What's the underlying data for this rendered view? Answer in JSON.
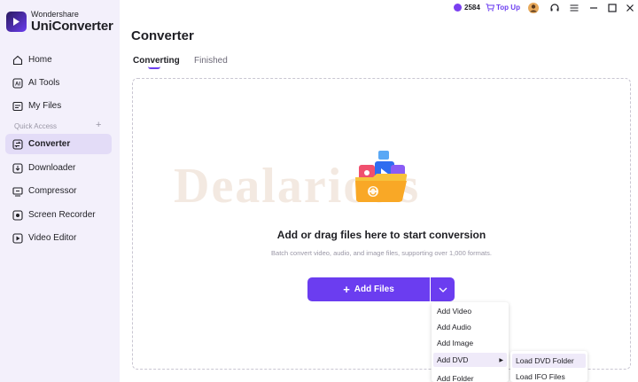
{
  "brand": {
    "small": "Wondershare",
    "big": "UniConverter"
  },
  "sidebar": {
    "items": [
      {
        "label": "Home",
        "icon": "home-icon"
      },
      {
        "label": "AI Tools",
        "icon": "ai-icon"
      },
      {
        "label": "My Files",
        "icon": "folder-icon"
      },
      {
        "label": "Converter",
        "icon": "converter-icon",
        "active": true
      },
      {
        "label": "Downloader",
        "icon": "download-icon"
      },
      {
        "label": "Compressor",
        "icon": "compress-icon"
      },
      {
        "label": "Screen Recorder",
        "icon": "record-icon"
      },
      {
        "label": "Video Editor",
        "icon": "video-editor-icon"
      }
    ],
    "quick_access": "Quick Access",
    "quick_access_add": "+"
  },
  "topbar": {
    "points": "2584",
    "topup": "Top Up"
  },
  "main": {
    "title": "Converter",
    "tabs": [
      {
        "label": "Converting",
        "active": true
      },
      {
        "label": "Finished"
      }
    ],
    "drop_title": "Add or drag files here to start conversion",
    "drop_sub": "Batch convert video, audio, and image files, supporting over 1,000 formats.",
    "add_files": "Add Files",
    "watermark": "Dealarious"
  },
  "menu": {
    "items": [
      "Add Video",
      "Add Audio",
      "Add Image",
      "Add DVD",
      "Add Folder"
    ],
    "submenu": [
      "Load DVD Folder",
      "Load IFO Files"
    ]
  },
  "colors": {
    "accent": "#6b3df0",
    "sidebar_bg": "#f3f0fb",
    "active_bg": "#e3dcf7"
  }
}
